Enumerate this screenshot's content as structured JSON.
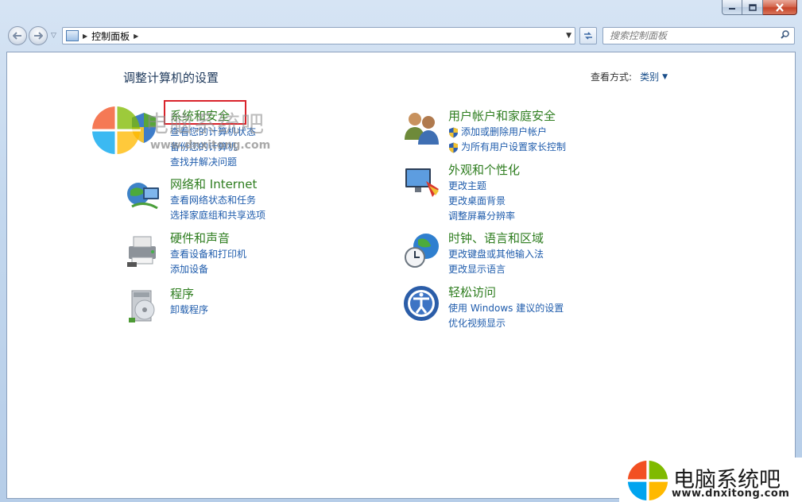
{
  "window": {
    "caption_buttons": [
      {
        "name": "minimize",
        "icon": "minimize-icon"
      },
      {
        "name": "maximize",
        "icon": "maximize-icon"
      },
      {
        "name": "close",
        "icon": "close-icon"
      }
    ]
  },
  "toolbar": {
    "address_path": "控制面板",
    "search_placeholder": "搜索控制面板"
  },
  "main": {
    "title": "调整计算机的设置",
    "view_by_label": "查看方式:",
    "view_by_value": "类别"
  },
  "categories": [
    {
      "title": "系统和安全",
      "icon": "system-security-icon",
      "highlighted": true,
      "links": [
        {
          "text": "查看您的计算机状态",
          "shield": false
        },
        {
          "text": "备份您的计算机",
          "shield": false
        },
        {
          "text": "查找并解决问题",
          "shield": false
        }
      ]
    },
    {
      "title": "网络和 Internet",
      "icon": "network-icon",
      "links": [
        {
          "text": "查看网络状态和任务",
          "shield": false
        },
        {
          "text": "选择家庭组和共享选项",
          "shield": false
        }
      ]
    },
    {
      "title": "硬件和声音",
      "icon": "hardware-sound-icon",
      "links": [
        {
          "text": "查看设备和打印机",
          "shield": false
        },
        {
          "text": "添加设备",
          "shield": false
        }
      ]
    },
    {
      "title": "程序",
      "icon": "programs-icon",
      "links": [
        {
          "text": "卸载程序",
          "shield": false
        }
      ]
    },
    {
      "title": "用户帐户和家庭安全",
      "icon": "user-accounts-icon",
      "links": [
        {
          "text": "添加或删除用户帐户",
          "shield": true
        },
        {
          "text": "为所有用户设置家长控制",
          "shield": true
        }
      ]
    },
    {
      "title": "外观和个性化",
      "icon": "appearance-icon",
      "links": [
        {
          "text": "更改主题",
          "shield": false
        },
        {
          "text": "更改桌面背景",
          "shield": false
        },
        {
          "text": "调整屏幕分辨率",
          "shield": false
        }
      ]
    },
    {
      "title": "时钟、语言和区域",
      "icon": "clock-language-icon",
      "links": [
        {
          "text": "更改键盘或其他输入法",
          "shield": false
        },
        {
          "text": "更改显示语言",
          "shield": false
        }
      ]
    },
    {
      "title": "轻松访问",
      "icon": "ease-of-access-icon",
      "links": [
        {
          "text": "使用 Windows 建议的设置",
          "shield": false
        },
        {
          "text": "优化视频显示",
          "shield": false
        }
      ]
    }
  ],
  "watermark": {
    "brand": "电脑系统吧",
    "url": "www.dnxitong.com"
  },
  "colors": {
    "category_title": "#2e7d1f",
    "link": "#1f5cac",
    "highlight_box": "#d9232b"
  }
}
